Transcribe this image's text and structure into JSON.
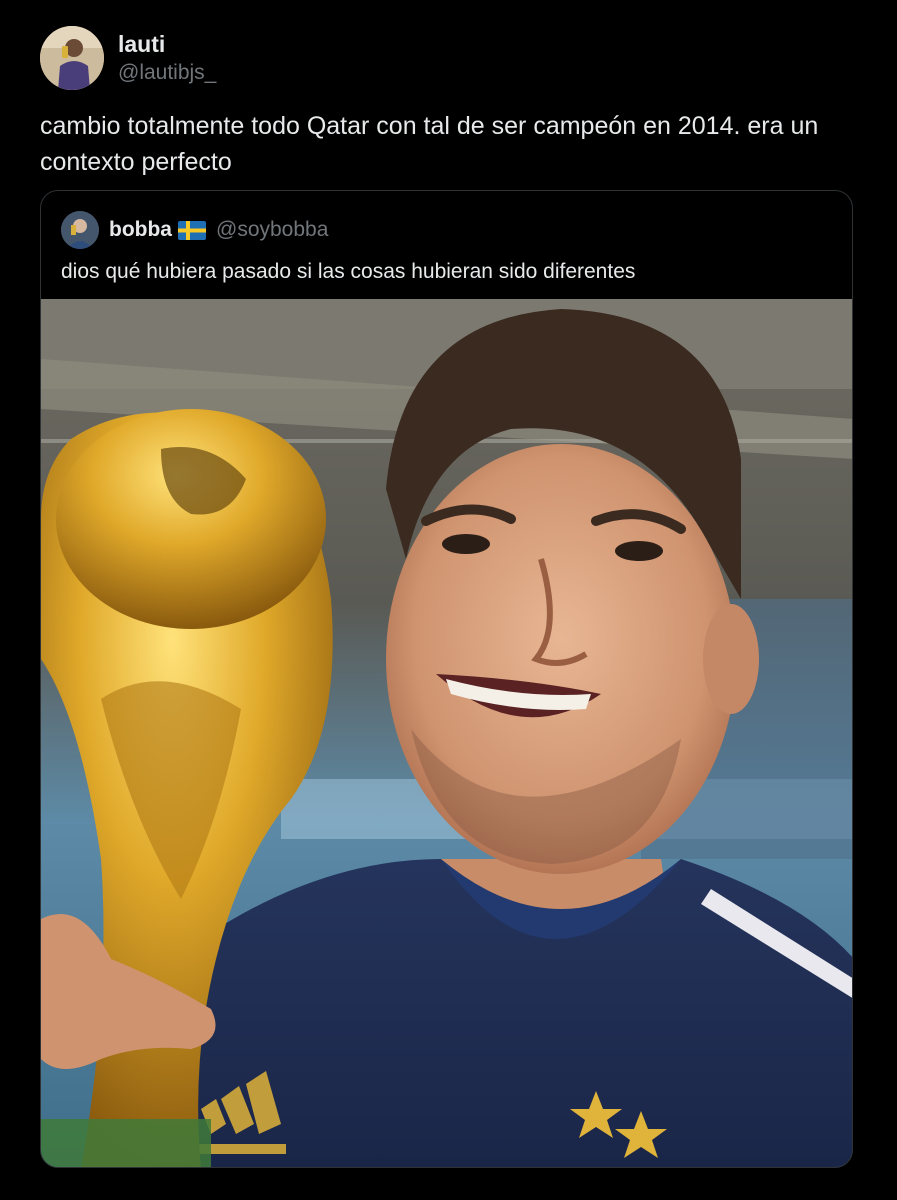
{
  "author": {
    "display_name": "lauti",
    "handle": "@lautibjs_",
    "avatar_icon": "profile-photo"
  },
  "tweet": {
    "text": "cambio totalmente todo Qatar con tal de ser campeón en 2014. era un contexto perfecto"
  },
  "quoted": {
    "display_name": "bobba",
    "flag_icon": "sweden-flag-icon",
    "handle": "@soybobba",
    "text": "dios qué hubiera pasado si las cosas hubieran sido diferentes",
    "media": "selfie with golden trophy"
  },
  "colors": {
    "background": "#000000",
    "text": "#e7e9ea",
    "muted": "#71767b",
    "border": "#2f3336"
  }
}
